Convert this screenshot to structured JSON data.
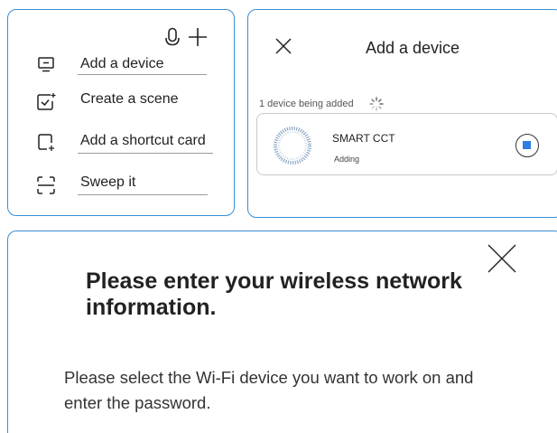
{
  "menu": {
    "items": [
      {
        "label": "Add a device",
        "icon": "device-icon"
      },
      {
        "label": "Create a scene",
        "icon": "scene-icon"
      },
      {
        "label": "Add a shortcut card",
        "icon": "shortcut-card-icon"
      },
      {
        "label": "Sweep it",
        "icon": "scan-icon"
      }
    ],
    "header_icons": [
      "microphone-icon",
      "plus-icon"
    ]
  },
  "add_device": {
    "title": "Add a device",
    "adding_count": "1 device being added",
    "device": {
      "name": "SMART CCT",
      "status": "Adding"
    },
    "accent_color": "#2e7fe0"
  },
  "wifi": {
    "heading": "Please enter your wireless network information.",
    "description": "Please select the Wi-Fi device you want to work on and enter the password."
  },
  "colors": {
    "panel_border": "#3a8fd6",
    "stop_fill": "#2e7fe0"
  }
}
